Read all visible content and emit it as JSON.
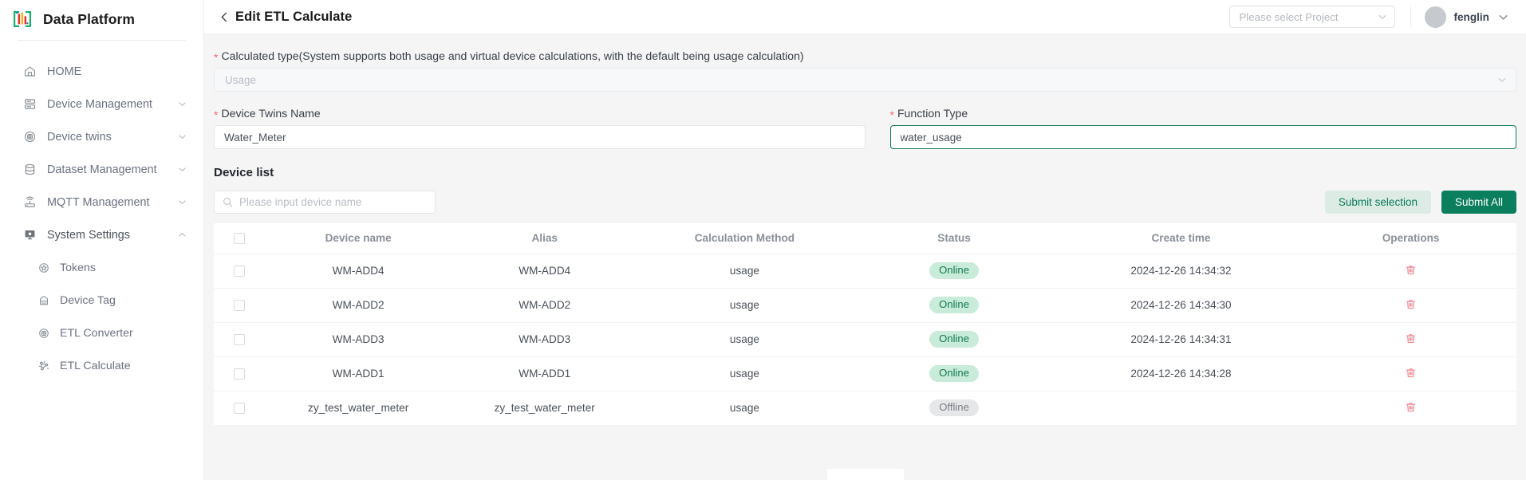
{
  "brand": {
    "title": "Data Platform",
    "logo_icon": "chart-logo-icon"
  },
  "sidebar": {
    "items": [
      {
        "label": "HOME",
        "icon": "home-icon",
        "level": 1,
        "expandable": false
      },
      {
        "label": "Device Management",
        "icon": "server-icon",
        "level": 1,
        "expandable": true,
        "expanded": false
      },
      {
        "label": "Device twins",
        "icon": "twins-circle-icon",
        "level": 1,
        "expandable": true,
        "expanded": false
      },
      {
        "label": "Dataset Management",
        "icon": "database-icon",
        "level": 1,
        "expandable": true,
        "expanded": false
      },
      {
        "label": "MQTT Management",
        "icon": "router-signal-icon",
        "level": 1,
        "expandable": true,
        "expanded": false
      },
      {
        "label": "System Settings",
        "icon": "monitor-gear-icon",
        "level": 1,
        "expandable": true,
        "expanded": true
      },
      {
        "label": "Tokens",
        "icon": "star-badge-icon",
        "level": 2,
        "expandable": false
      },
      {
        "label": "Device Tag",
        "icon": "tag-icon",
        "level": 2,
        "expandable": false
      },
      {
        "label": "ETL Converter",
        "icon": "converter-icon",
        "level": 2,
        "expandable": false
      },
      {
        "label": "ETL Calculate",
        "icon": "calculate-nodes-icon",
        "level": 2,
        "expandable": false
      }
    ]
  },
  "topbar": {
    "back_icon": "chevron-left-icon",
    "title": "Edit ETL Calculate",
    "project_select": {
      "placeholder": "Please select Project",
      "value": "",
      "arrow_icon": "chevron-down-icon"
    },
    "user": {
      "name": "fenglin",
      "avatar_icon": "avatar",
      "arrow_icon": "chevron-down-icon"
    }
  },
  "form": {
    "calculated_type": {
      "label": "Calculated type(System supports both usage and virtual device calculations, with the default being usage calculation)",
      "required": true,
      "value": "Usage",
      "disabled": true,
      "arrow_icon": "chevron-down-icon"
    },
    "device_twins_name": {
      "label": "Device Twins Name",
      "required": true,
      "value": "Water_Meter",
      "placeholder": "",
      "focused": false
    },
    "function_type": {
      "label": "Function Type",
      "required": true,
      "value": "water_usage",
      "placeholder": "",
      "focused": true
    }
  },
  "device_list": {
    "section_title": "Device list",
    "search": {
      "placeholder": "Please input device name",
      "value": "",
      "icon": "search-icon"
    },
    "buttons": {
      "submit_selection": "Submit selection",
      "submit_all": "Submit All"
    },
    "columns": [
      "",
      "Device name",
      "Alias",
      "Calculation Method",
      "Status",
      "Create time",
      "Operations"
    ],
    "rows": [
      {
        "checked": false,
        "device_name": "WM-ADD4",
        "alias": "WM-ADD4",
        "method": "usage",
        "status": "Online",
        "create_time": "2024-12-26 14:34:32",
        "delete_icon": "trash-icon"
      },
      {
        "checked": false,
        "device_name": "WM-ADD2",
        "alias": "WM-ADD2",
        "method": "usage",
        "status": "Online",
        "create_time": "2024-12-26 14:34:30",
        "delete_icon": "trash-icon"
      },
      {
        "checked": false,
        "device_name": "WM-ADD3",
        "alias": "WM-ADD3",
        "method": "usage",
        "status": "Online",
        "create_time": "2024-12-26 14:34:31",
        "delete_icon": "trash-icon"
      },
      {
        "checked": false,
        "device_name": "WM-ADD1",
        "alias": "WM-ADD1",
        "method": "usage",
        "status": "Online",
        "create_time": "2024-12-26 14:34:28",
        "delete_icon": "trash-icon"
      },
      {
        "checked": false,
        "device_name": "zy_test_water_meter",
        "alias": "zy_test_water_meter",
        "method": "usage",
        "status": "Offline",
        "create_time": "",
        "delete_icon": "trash-icon"
      }
    ]
  },
  "colors": {
    "accent_green": "#0a7e5d",
    "accent_green_soft": "#dcebe4",
    "badge_online_bg": "#c8ecd9",
    "badge_online_text": "#157a52",
    "badge_offline_bg": "#e6e7e9",
    "badge_offline_text": "#7b8189",
    "required_star": "#f2697a",
    "delete_icon": "#f4848f",
    "page_bg": "#f5f5f5",
    "sidebar_bg": "#ffffff"
  }
}
